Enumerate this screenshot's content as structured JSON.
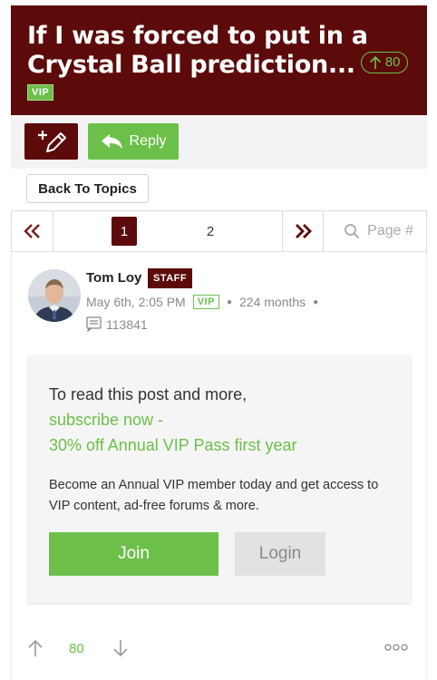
{
  "topic": {
    "title": "If I was forced to put in a Crystal Ball prediction...",
    "score": "80",
    "vip_label": "VIP"
  },
  "toolbar": {
    "compose_icon": "compose-pencil-icon",
    "reply_label": "Reply"
  },
  "navigation": {
    "back_label": "Back To Topics"
  },
  "pagination": {
    "pages": [
      "1",
      "2"
    ],
    "current": "1",
    "search_placeholder": "Page #"
  },
  "post": {
    "author": "Tom Loy",
    "author_badge": "STAFF",
    "date": "May 6th, 2:05 PM",
    "vip_label": "VIP",
    "tenure": "224 months",
    "post_count": "113841"
  },
  "paywall": {
    "line1": "To read this post and more,",
    "line2": "subscribe now -",
    "line3": "30% off Annual VIP Pass first year",
    "description": "Become an Annual VIP member today and get access to VIP content, ad-free forums & more.",
    "join_label": "Join",
    "login_label": "Login"
  },
  "votes": {
    "count": "80"
  },
  "colors": {
    "brand": "#5c0a0a",
    "accent": "#6cc04a"
  }
}
